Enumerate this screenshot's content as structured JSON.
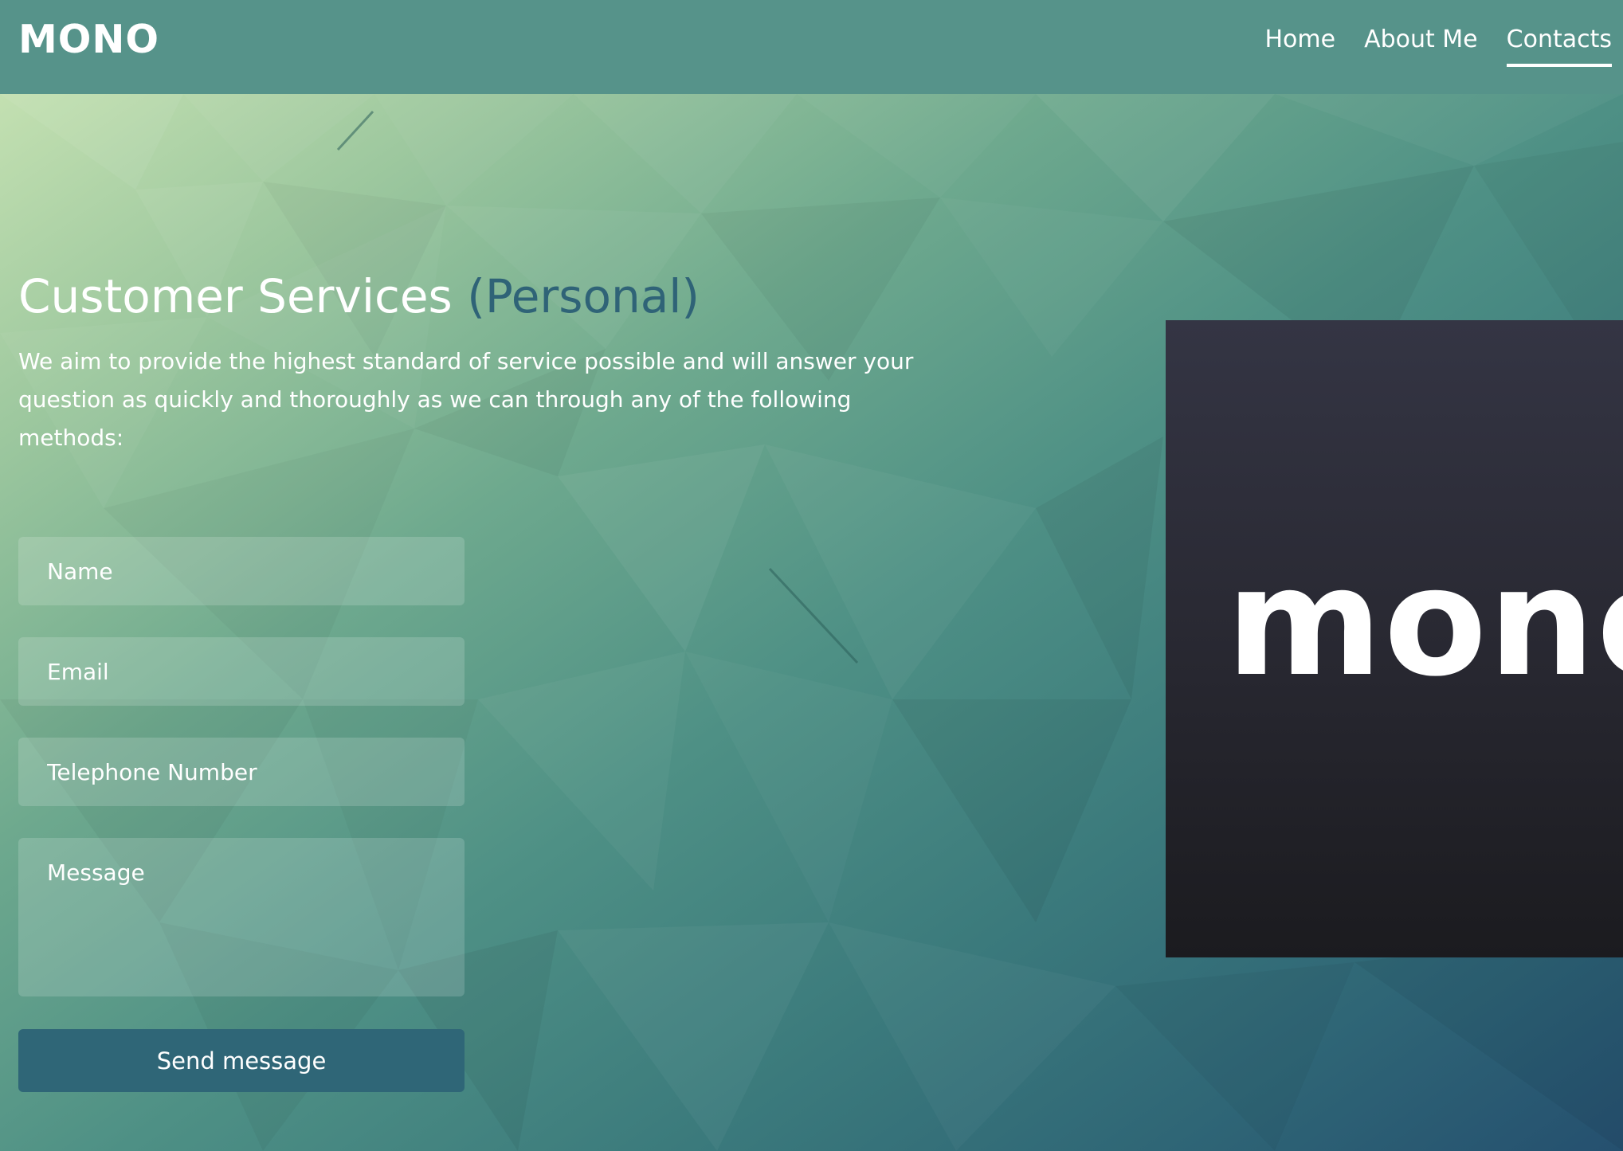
{
  "navbar": {
    "brand": "MONO",
    "links": [
      {
        "label": "Home",
        "active": false
      },
      {
        "label": "About Me",
        "active": false
      },
      {
        "label": "Contacts",
        "active": true
      }
    ]
  },
  "hero": {
    "title_main": "Customer Services ",
    "title_accent": "(Personal)",
    "intro": "We aim to provide the highest standard of service possible and will answer your question as quickly and thoroughly as we can through any of the following methods:"
  },
  "form": {
    "name_placeholder": "Name",
    "email_placeholder": "Email",
    "tel_placeholder": "Telephone Number",
    "message_placeholder": "Message",
    "submit_label": "Send message"
  },
  "logo_card": {
    "text": "mono"
  },
  "colors": {
    "navbar": "#56938a",
    "accent": "#2f6377",
    "button": "#2f6677",
    "logo_card": "#2a2a34"
  }
}
